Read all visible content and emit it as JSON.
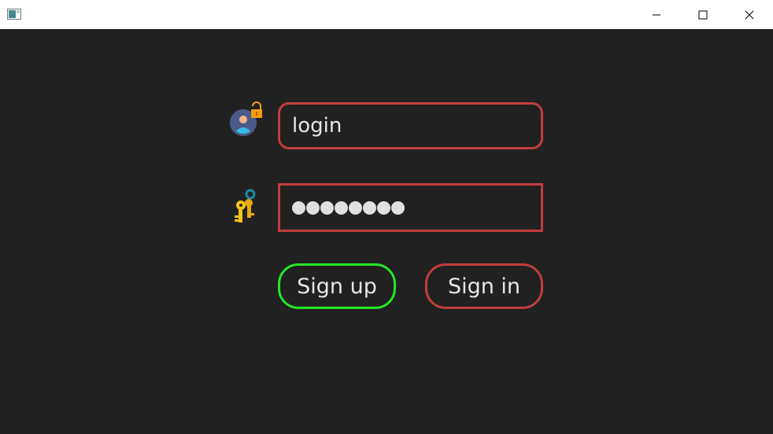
{
  "window": {
    "title": "",
    "controls": {
      "minimize": "minimize",
      "maximize": "maximize",
      "close": "close"
    }
  },
  "form": {
    "login": {
      "value": "login",
      "icon": "user-lock-icon"
    },
    "password": {
      "masked_length": 8,
      "icon": "key-icon"
    },
    "buttons": {
      "signup_label": "Sign up",
      "signin_label": "Sign in"
    }
  },
  "colors": {
    "background": "#212121",
    "field_border": "#c23d3d",
    "signup_border": "#22e822",
    "text": "#e6e6e6"
  }
}
